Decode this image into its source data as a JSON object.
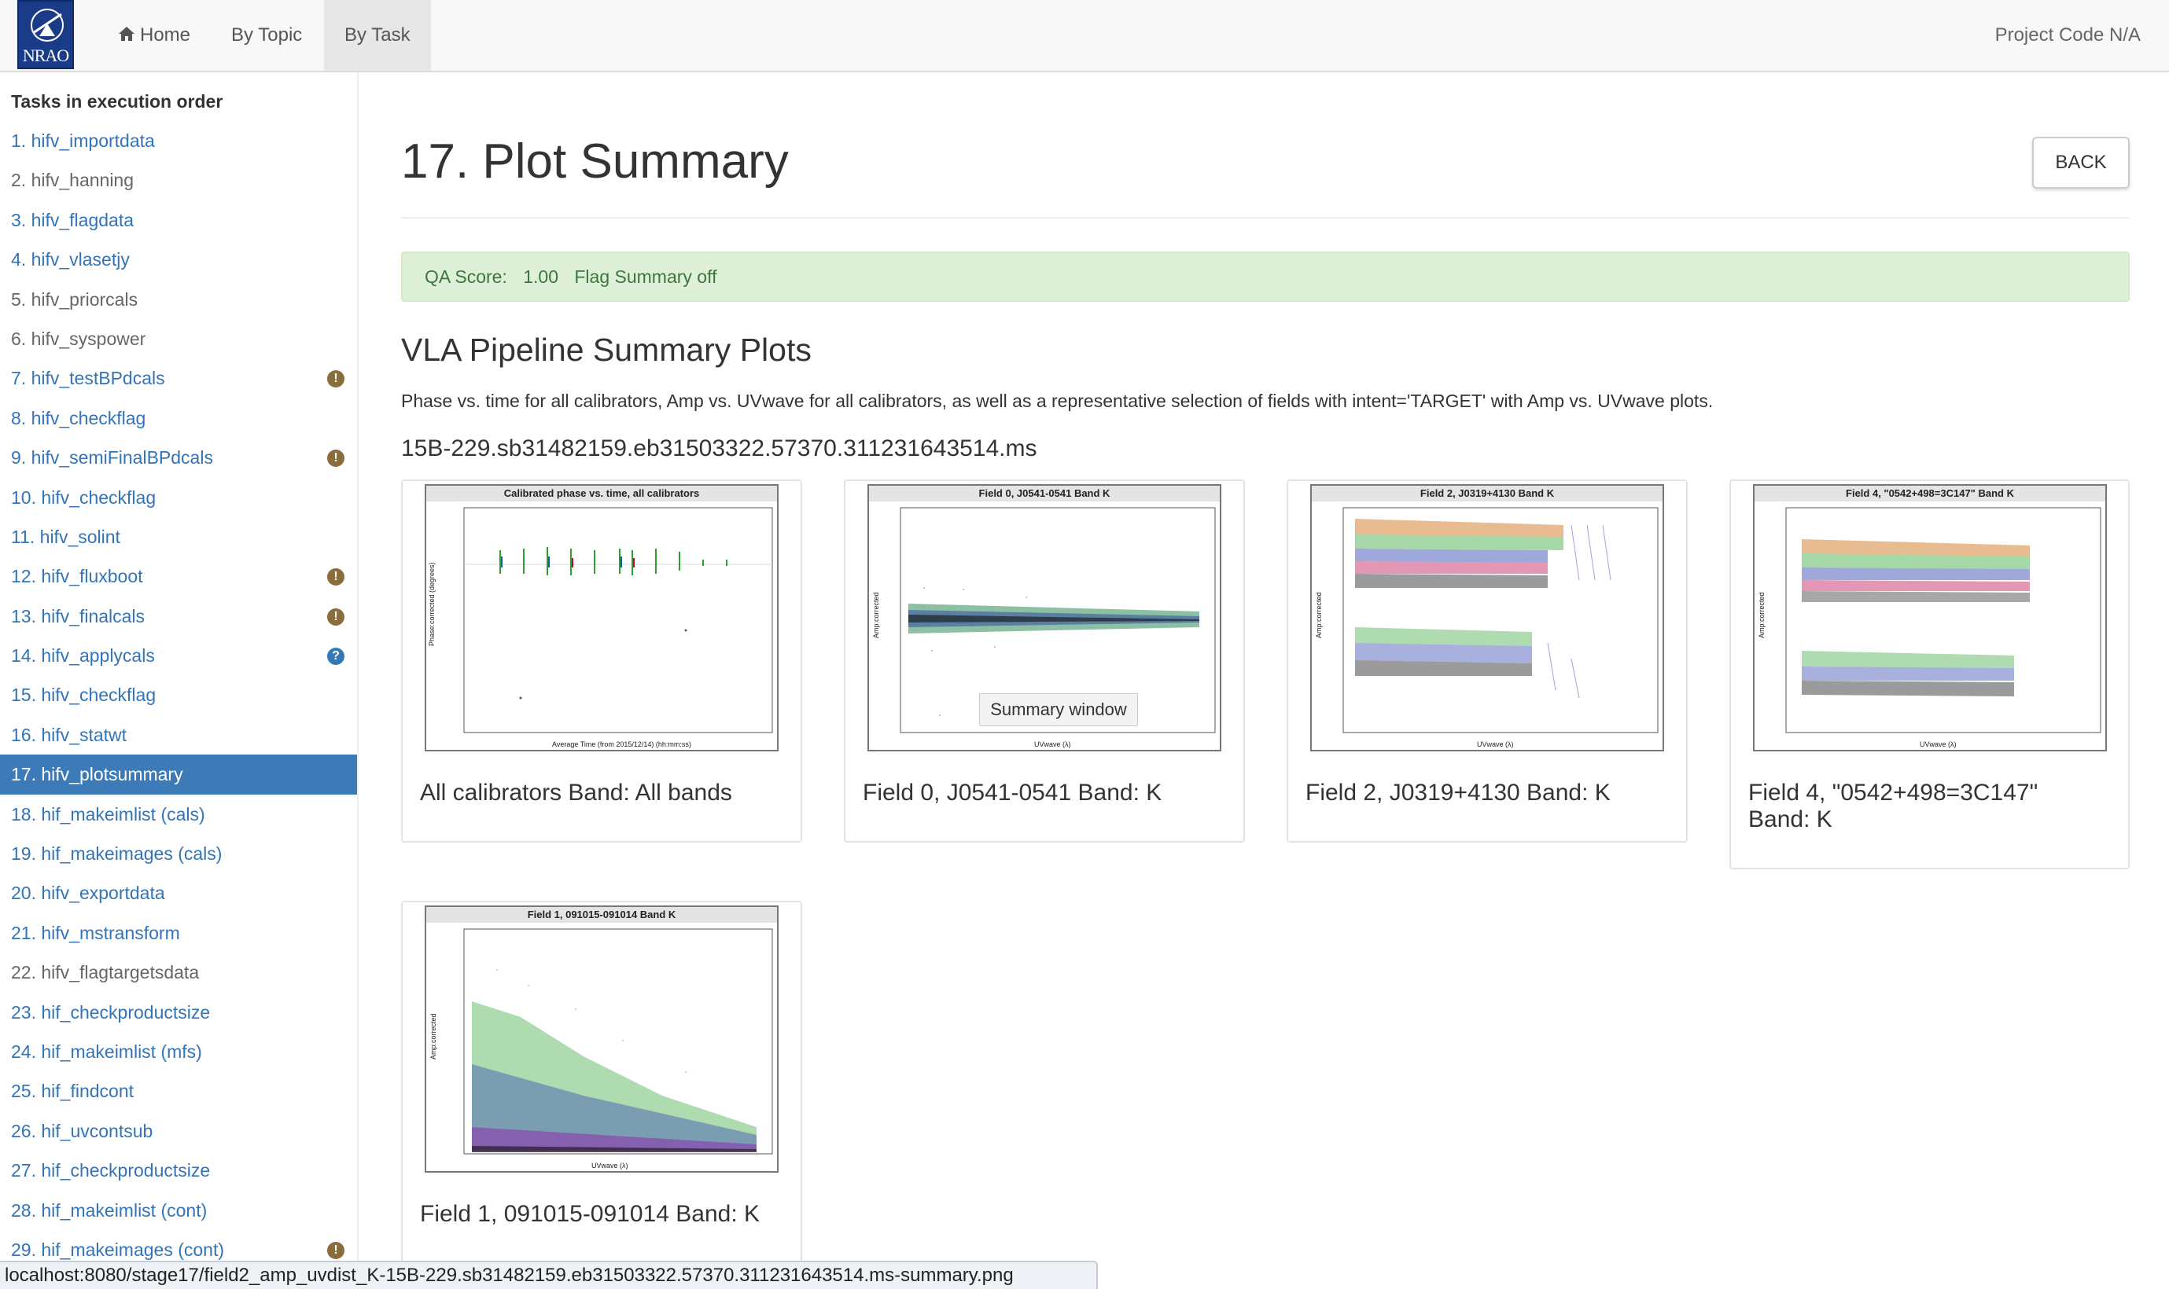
{
  "nav": {
    "logo_text": "NRAO",
    "home": "Home",
    "by_topic": "By Topic",
    "by_task": "By Task",
    "project_code": "Project Code N/A"
  },
  "sidebar": {
    "heading": "Tasks in execution order",
    "items": [
      {
        "label": "1. hifv_importdata",
        "style": "link",
        "badge": ""
      },
      {
        "label": "2. hifv_hanning",
        "style": "plain",
        "badge": ""
      },
      {
        "label": "3. hifv_flagdata",
        "style": "link",
        "badge": ""
      },
      {
        "label": "4. hifv_vlasetjy",
        "style": "link",
        "badge": ""
      },
      {
        "label": "5. hifv_priorcals",
        "style": "plain",
        "badge": ""
      },
      {
        "label": "6. hifv_syspower",
        "style": "plain",
        "badge": ""
      },
      {
        "label": "7. hifv_testBPdcals",
        "style": "link",
        "badge": "warn"
      },
      {
        "label": "8. hifv_checkflag",
        "style": "link",
        "badge": ""
      },
      {
        "label": "9. hifv_semiFinalBPdcals",
        "style": "link",
        "badge": "warn"
      },
      {
        "label": "10. hifv_checkflag",
        "style": "link",
        "badge": ""
      },
      {
        "label": "11. hifv_solint",
        "style": "link",
        "badge": ""
      },
      {
        "label": "12. hifv_fluxboot",
        "style": "link",
        "badge": "warn"
      },
      {
        "label": "13. hifv_finalcals",
        "style": "link",
        "badge": "warn"
      },
      {
        "label": "14. hifv_applycals",
        "style": "link",
        "badge": "info"
      },
      {
        "label": "15. hifv_checkflag",
        "style": "link",
        "badge": ""
      },
      {
        "label": "16. hifv_statwt",
        "style": "link",
        "badge": ""
      },
      {
        "label": "17. hifv_plotsummary",
        "style": "active",
        "badge": ""
      },
      {
        "label": "18. hif_makeimlist (cals)",
        "style": "link",
        "badge": ""
      },
      {
        "label": "19. hif_makeimages (cals)",
        "style": "link",
        "badge": ""
      },
      {
        "label": "20. hifv_exportdata",
        "style": "link",
        "badge": ""
      },
      {
        "label": "21. hifv_mstransform",
        "style": "link",
        "badge": ""
      },
      {
        "label": "22. hifv_flagtargetsdata",
        "style": "plain",
        "badge": ""
      },
      {
        "label": "23. hif_checkproductsize",
        "style": "link",
        "badge": ""
      },
      {
        "label": "24. hif_makeimlist (mfs)",
        "style": "link",
        "badge": ""
      },
      {
        "label": "25. hif_findcont",
        "style": "link",
        "badge": ""
      },
      {
        "label": "26. hif_uvcontsub",
        "style": "link",
        "badge": ""
      },
      {
        "label": "27. hif_checkproductsize",
        "style": "link",
        "badge": ""
      },
      {
        "label": "28. hif_makeimlist (cont)",
        "style": "link",
        "badge": ""
      },
      {
        "label": "29. hif_makeimages (cont)",
        "style": "link",
        "badge": "warn"
      }
    ]
  },
  "main": {
    "title": "17. Plot Summary",
    "back": "BACK",
    "qa_label": "QA Score:",
    "qa_value": "1.00",
    "qa_flag": "Flag Summary off",
    "section_title": "VLA Pipeline Summary Plots",
    "description": "Phase vs. time for all calibrators, Amp vs. UVwave for all calibrators, as well as a representative selection of fields with intent='TARGET' with Amp vs. UVwave plots.",
    "ms_name": "15B-229.sb31482159.eb31503322.57370.311231643514.ms",
    "cards": [
      {
        "plot_title": "Calibrated phase vs. time, all calibrators",
        "caption": "All calibrators Band: All bands"
      },
      {
        "plot_title": "Field 0, J0541-0541   Band K",
        "caption": "Field 0, J0541-0541 Band: K"
      },
      {
        "plot_title": "Field 2, J0319+4130   Band K",
        "caption": "Field 2, J0319+4130 Band: K"
      },
      {
        "plot_title": "Field 4, \"0542+498=3C147\"   Band K",
        "caption": "Field 4, \"0542+498=3C147\" Band: K"
      },
      {
        "plot_title": "Field 1, 091015-091014   Band K",
        "caption": "Field 1, 091015-091014 Band: K"
      }
    ],
    "tooltip": "Summary window"
  },
  "status_url": "localhost:8080/stage17/field2_amp_uvdist_K-15B-229.sb31482159.eb31503322.57370.311231643514.ms-summary.png",
  "colors": {
    "link": "#3374b8",
    "active_bg": "#3d7ab8",
    "qa_bg": "#dff0d8",
    "qa_text": "#3c763d",
    "warn": "#8a6d3b",
    "info": "#337ab7"
  }
}
